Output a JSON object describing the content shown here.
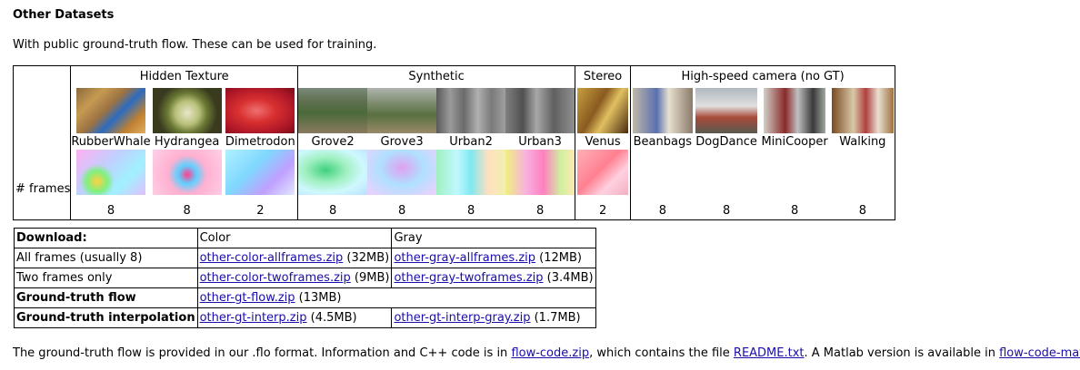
{
  "section": {
    "heading": "Other Datasets",
    "intro": "With public ground-truth flow. These can be used for training."
  },
  "groups": [
    {
      "label": "Hidden Texture"
    },
    {
      "label": "Synthetic"
    },
    {
      "label": "Stereo"
    },
    {
      "label": "High-speed camera (no GT)"
    }
  ],
  "frames_label": "# frames",
  "datasets": [
    {
      "name": "RubberWhale",
      "frames": "8",
      "group": "Hidden Texture"
    },
    {
      "name": "Hydrangea",
      "frames": "8",
      "group": "Hidden Texture"
    },
    {
      "name": "Dimetrodon",
      "frames": "2",
      "group": "Hidden Texture"
    },
    {
      "name": "Grove2",
      "frames": "8",
      "group": "Synthetic"
    },
    {
      "name": "Grove3",
      "frames": "8",
      "group": "Synthetic"
    },
    {
      "name": "Urban2",
      "frames": "8",
      "group": "Synthetic"
    },
    {
      "name": "Urban3",
      "frames": "8",
      "group": "Synthetic"
    },
    {
      "name": "Venus",
      "frames": "2",
      "group": "Stereo"
    },
    {
      "name": "Beanbags",
      "frames": "8",
      "group": "High-speed camera (no GT)"
    },
    {
      "name": "DogDance",
      "frames": "8",
      "group": "High-speed camera (no GT)"
    },
    {
      "name": "MiniCooper",
      "frames": "8",
      "group": "High-speed camera (no GT)"
    },
    {
      "name": "Walking",
      "frames": "8",
      "group": "High-speed camera (no GT)"
    }
  ],
  "download": {
    "header": {
      "label": "Download:",
      "color": "Color",
      "gray": "Gray"
    },
    "rows": [
      {
        "label": "All frames (usually 8)",
        "color_link": "other-color-allframes.zip",
        "color_size": " (32MB)",
        "gray_link": "other-gray-allframes.zip",
        "gray_size": " (12MB)"
      },
      {
        "label": "Two frames only",
        "color_link": "other-color-twoframes.zip",
        "color_size": " (9MB)",
        "gray_link": "other-gray-twoframes.zip",
        "gray_size": " (3.4MB)"
      },
      {
        "label": "Ground-truth flow",
        "color_link": "other-gt-flow.zip",
        "color_size": " (13MB)"
      },
      {
        "label": "Ground-truth interpolation",
        "color_link": "other-gt-interp.zip",
        "color_size": " (4.5MB)",
        "gray_link": "other-gt-interp-gray.zip",
        "gray_size": " (1.7MB)"
      }
    ]
  },
  "footer": {
    "text1": "The ground-truth flow is provided in our .flo format. Information and C++ code is in ",
    "link1": "flow-code.zip",
    "text2": ", which contains the file ",
    "link2": "README.txt",
    "text3": ". A Matlab version is available in ",
    "link3": "flow-code-matlab.zip",
    "text4": "."
  },
  "colors": {
    "link": "#1a0dab",
    "border": "#000000"
  }
}
